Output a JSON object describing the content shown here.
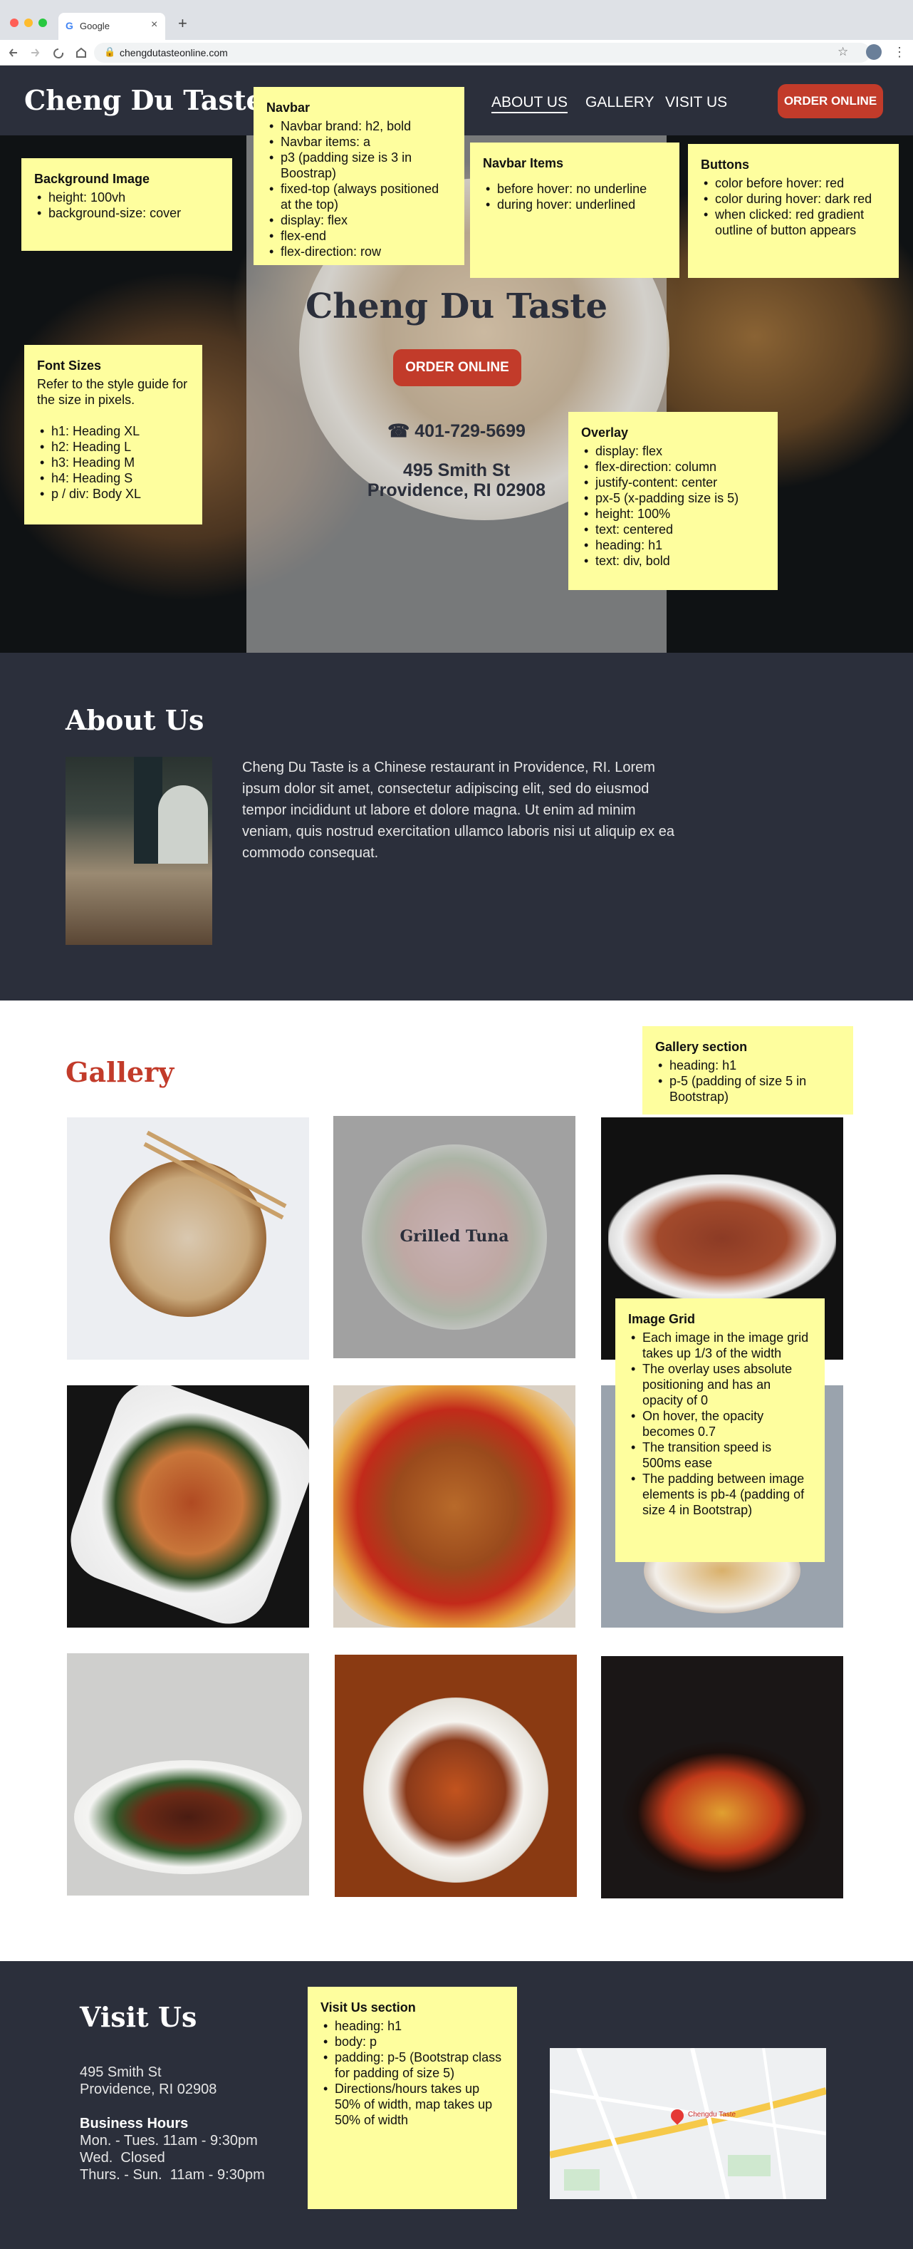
{
  "browser": {
    "tab_title": "Google",
    "url": "chengdutasteonline.com",
    "close_glyph": "×",
    "new_tab_glyph": "+"
  },
  "navbar": {
    "brand": "Cheng Du Taste",
    "items": [
      "ABOUT US",
      "GALLERY",
      "VISIT US"
    ],
    "order_button": "ORDER ONLINE"
  },
  "hero": {
    "title": "Cheng Du Taste",
    "order_button": "ORDER ONLINE",
    "phone": "401-729-5699",
    "address_line1": "495 Smith St",
    "address_line2": "Providence, RI 02908"
  },
  "notes": {
    "background_image": {
      "heading": "Background Image",
      "items": [
        "height: 100vh",
        "background-size: cover"
      ]
    },
    "navbar": {
      "heading": "Navbar",
      "items": [
        "Navbar brand: h2, bold",
        "Navbar items: a",
        "p3 (padding size is 3 in Boostrap)",
        "fixed-top (always positioned at the top)",
        "display: flex",
        "flex-end",
        "flex-direction: row"
      ]
    },
    "navbar_items": {
      "heading": "Navbar Items",
      "items": [
        "before hover: no underline",
        "during hover: underlined"
      ]
    },
    "buttons": {
      "heading": "Buttons",
      "items": [
        "color before hover: red",
        "color during hover: dark red",
        "when clicked: red gradient outline of button appears"
      ]
    },
    "font_sizes": {
      "heading": "Font Sizes",
      "intro": "Refer to the style guide for the size in pixels.",
      "items": [
        "h1: Heading XL",
        "h2: Heading L",
        "h3: Heading M",
        "h4: Heading S",
        "p / div: Body XL"
      ]
    },
    "overlay": {
      "heading": "Overlay",
      "items": [
        "display: flex",
        "flex-direction: column",
        "justify-content: center",
        "px-5 (x-padding size is 5)",
        "height: 100%",
        "text: centered",
        "heading: h1",
        "text: div, bold"
      ]
    },
    "gallery_section": {
      "heading": "Gallery section",
      "items": [
        "heading: h1",
        "p-5 (padding of size 5 in Bootstrap)"
      ]
    },
    "image_grid": {
      "heading": "Image Grid",
      "items": [
        "Each image in the image grid takes up 1/3 of the width",
        "The overlay uses absolute positioning and has an opacity of 0",
        "On hover, the opacity becomes 0.7",
        "The transition speed is 500ms ease",
        "The padding between image elements is pb-4 (padding of size 4 in Bootstrap)"
      ]
    },
    "visit_us": {
      "heading": "Visit Us section",
      "items": [
        "heading: h1",
        "body: p",
        "padding: p-5 (Bootstrap class for padding of size 5)",
        "Directions/hours takes up 50% of width, map takes up 50% of width"
      ]
    }
  },
  "about": {
    "title": "About Us",
    "text": "Cheng Du Taste is a Chinese restaurant in Providence, RI. Lorem ipsum dolor sit amet, consectetur adipiscing elit, sed do eiusmod tempor incididunt ut labore et dolore magna. Ut enim ad minim veniam, quis nostrud exercitation ullamco laboris nisi ut aliquip ex ea commodo consequat."
  },
  "gallery": {
    "title": "Gallery",
    "hover_label": "Grilled Tuna"
  },
  "visit": {
    "title": "Visit Us",
    "address_line1": "495 Smith St",
    "address_line2": "Providence, RI 02908",
    "hours_heading": "Business Hours",
    "hours": [
      "Mon. - Tues. 11am - 9:30pm",
      "Wed.  Closed",
      "Thurs. - Sun.  11am - 9:30pm"
    ],
    "map_pin_label": "Chengdu Taste"
  },
  "colors": {
    "brand_red": "#c23b2a",
    "dark_navy": "#2b2f3b",
    "note_yellow": "#fefe9e"
  }
}
